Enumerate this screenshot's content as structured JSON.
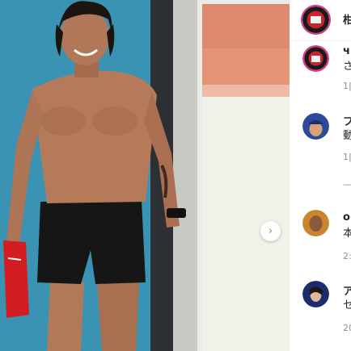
{
  "post": {
    "image_alt": "shirtless man standing in shorts holding red shirt"
  },
  "carousel": {
    "next_icon": "chevron-right-icon",
    "next_glyph": "›"
  },
  "header": {
    "username_fragment": "柑"
  },
  "comments": [
    {
      "avatar": "team-crest-avatar",
      "name_fragment": "чi",
      "text_fragment": "さ",
      "time_fragment": "1|"
    },
    {
      "avatar": "man-cap-avatar",
      "name_fragment": "フ",
      "text_fragment": "動",
      "time_fragment": "1|",
      "replies_fragment": "—"
    },
    {
      "avatar": "man-portrait-avatar",
      "name_fragment": "o",
      "text_fragment": "本",
      "time_fragment": "2:"
    },
    {
      "avatar": "person-portrait-avatar",
      "name_fragment": "ア",
      "text_fragment": "セ",
      "time_fragment": "20"
    }
  ]
}
